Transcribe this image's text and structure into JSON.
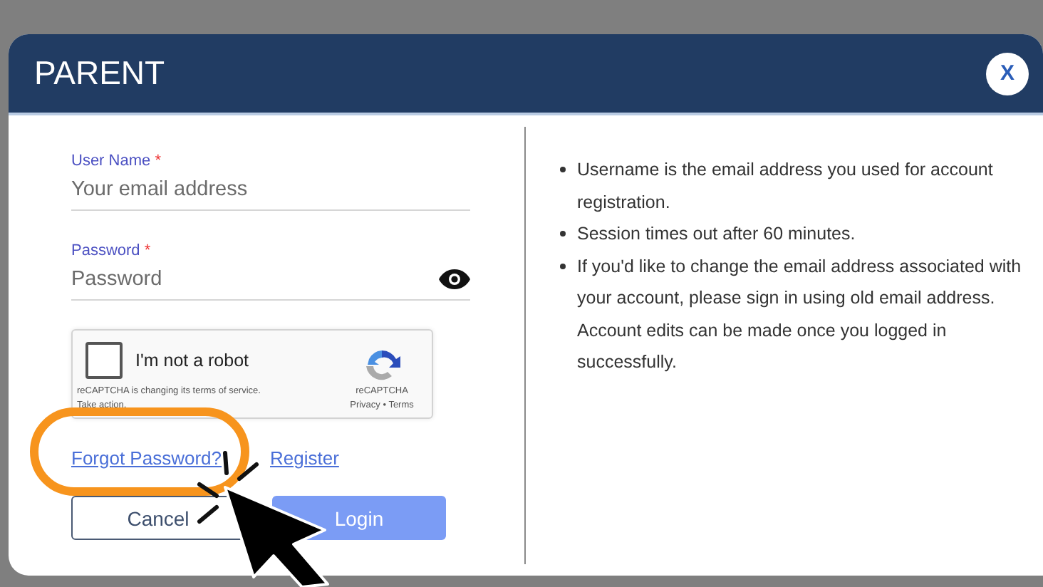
{
  "dialog": {
    "title": "PARENT",
    "close_label": "X"
  },
  "form": {
    "fields": [
      {
        "label": "User Name",
        "required_mark": "*",
        "placeholder": "Your email address",
        "kind": "text"
      },
      {
        "label": "Password",
        "required_mark": "*",
        "placeholder": "Password",
        "kind": "password"
      }
    ],
    "captcha": {
      "label": "I'm not a robot",
      "checked": false,
      "notice": "reCAPTCHA is changing its terms of service.",
      "notice_link": "Take action.",
      "brand": "reCAPTCHA",
      "links": "Privacy • Terms"
    },
    "links": [
      "Forgot Password?",
      "Register"
    ],
    "buttons": [
      {
        "label": "Cancel",
        "kind": "secondary"
      },
      {
        "label": "Login",
        "kind": "primary"
      }
    ]
  },
  "info": [
    "Username is the email address you used for account registration.",
    "Session times out after 60 minutes.",
    "If you'd like to change the email address associated with your account, please sign in using old email address. Account edits can be made once you logged in successfully."
  ]
}
